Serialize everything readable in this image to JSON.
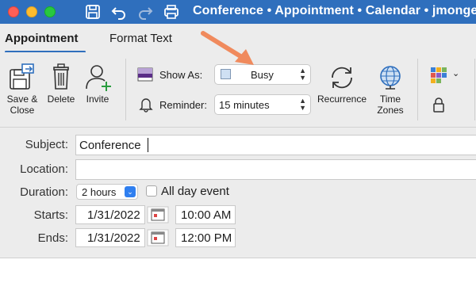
{
  "window": {
    "title": "Conference • Appointment • Calendar • jmonge"
  },
  "tabs": [
    {
      "label": "Appointment",
      "active": true
    },
    {
      "label": "Format Text",
      "active": false
    }
  ],
  "ribbon": {
    "save_close_label_line1": "Save &",
    "save_close_label_line2": "Close",
    "delete_label": "Delete",
    "invite_label": "Invite",
    "show_as_label": "Show As:",
    "show_as_value": "Busy",
    "reminder_label": "Reminder:",
    "reminder_value": "15 minutes",
    "recurrence_label": "Recurrence",
    "time_zones_line1": "Time",
    "time_zones_line2": "Zones",
    "accent_color": "#2f6fbd",
    "arrow_color": "#f08a5d"
  },
  "form": {
    "subject_label": "Subject:",
    "subject_value": "Conference",
    "location_label": "Location:",
    "location_value": "",
    "duration_label": "Duration:",
    "duration_value": "2 hours",
    "all_day_label": "All day event",
    "all_day_checked": false,
    "starts_label": "Starts:",
    "starts_date": "1/31/2022",
    "starts_time": "10:00 AM",
    "ends_label": "Ends:",
    "ends_date": "1/31/2022",
    "ends_time": "12:00 PM"
  }
}
